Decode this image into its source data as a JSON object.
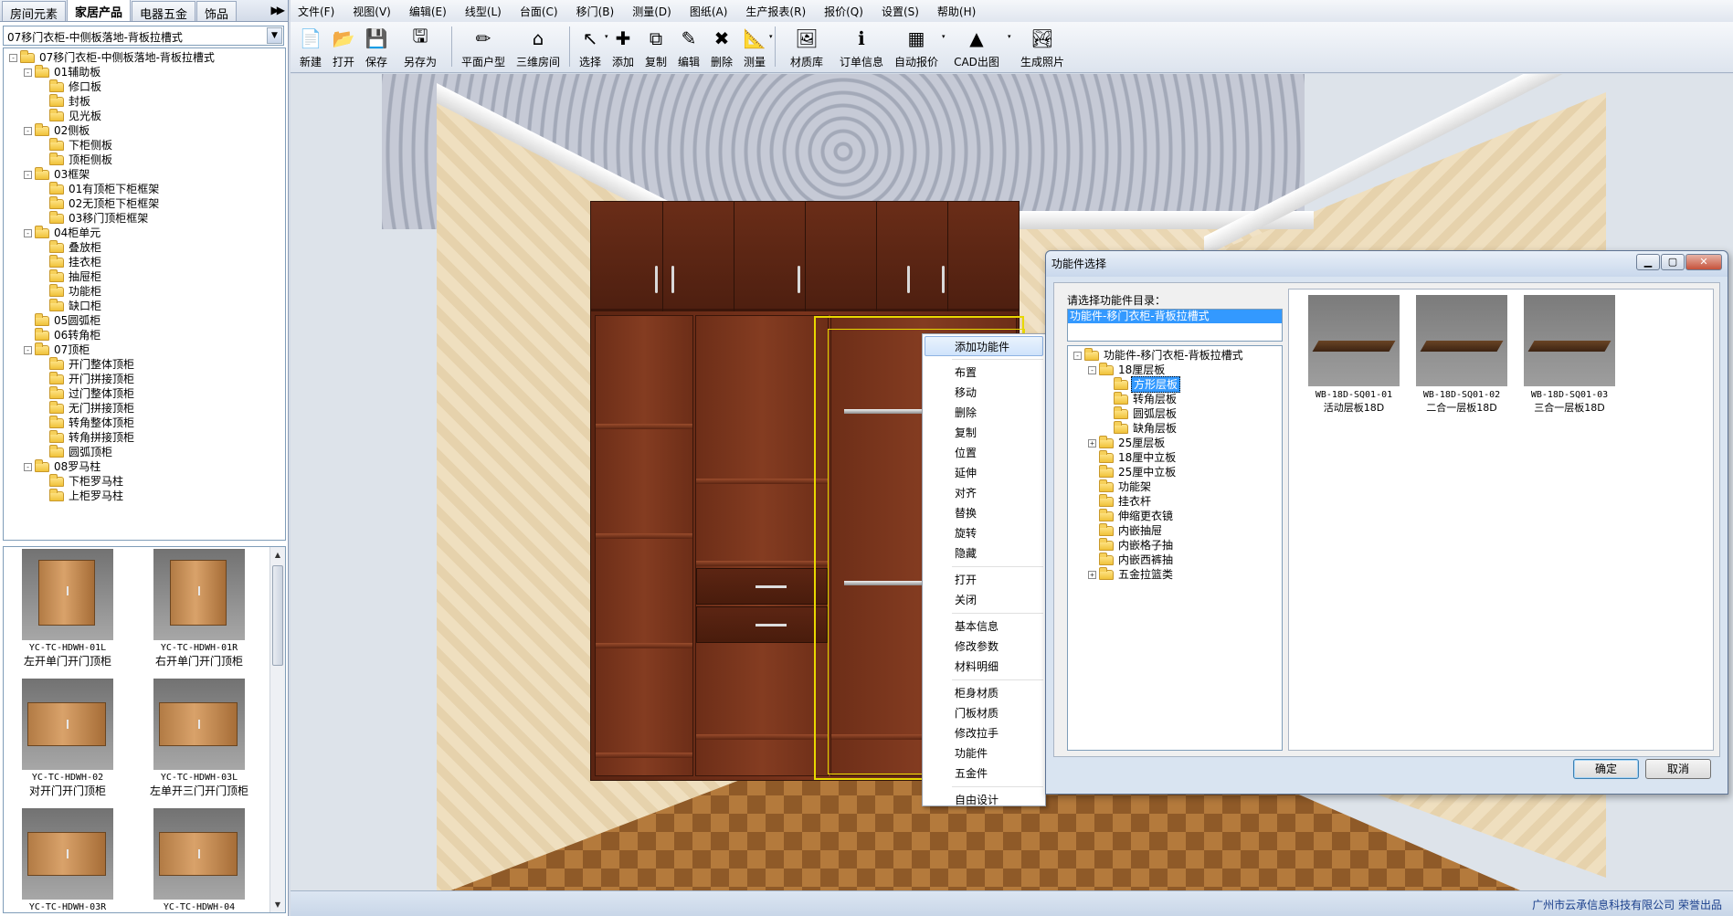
{
  "left_tabs": [
    "房间元素",
    "家居产品",
    "电器五金",
    "饰品"
  ],
  "left_tabs_active": 1,
  "combo_value": "07移门衣柜-中侧板落地-背板拉槽式",
  "tree": [
    {
      "label": "07移门衣柜-中侧板落地-背板拉槽式",
      "level": 0,
      "exp": "-"
    },
    {
      "label": "01辅助板",
      "level": 1,
      "exp": "-"
    },
    {
      "label": "修口板",
      "level": 2,
      "exp": ""
    },
    {
      "label": "封板",
      "level": 2,
      "exp": ""
    },
    {
      "label": "见光板",
      "level": 2,
      "exp": ""
    },
    {
      "label": "02侧板",
      "level": 1,
      "exp": "-"
    },
    {
      "label": "下柜侧板",
      "level": 2,
      "exp": ""
    },
    {
      "label": "顶柜侧板",
      "level": 2,
      "exp": ""
    },
    {
      "label": "03框架",
      "level": 1,
      "exp": "-"
    },
    {
      "label": "01有顶柜下柜框架",
      "level": 2,
      "exp": ""
    },
    {
      "label": "02无顶柜下柜框架",
      "level": 2,
      "exp": ""
    },
    {
      "label": "03移门顶柜框架",
      "level": 2,
      "exp": ""
    },
    {
      "label": "04柜单元",
      "level": 1,
      "exp": "-"
    },
    {
      "label": "叠放柜",
      "level": 2,
      "exp": ""
    },
    {
      "label": "挂衣柜",
      "level": 2,
      "exp": ""
    },
    {
      "label": "抽屉柜",
      "level": 2,
      "exp": ""
    },
    {
      "label": "功能柜",
      "level": 2,
      "exp": ""
    },
    {
      "label": "缺口柜",
      "level": 2,
      "exp": ""
    },
    {
      "label": "05圆弧柜",
      "level": 1,
      "exp": ""
    },
    {
      "label": "06转角柜",
      "level": 1,
      "exp": ""
    },
    {
      "label": "07顶柜",
      "level": 1,
      "exp": "-"
    },
    {
      "label": "开门整体顶柜",
      "level": 2,
      "exp": ""
    },
    {
      "label": "开门拼接顶柜",
      "level": 2,
      "exp": ""
    },
    {
      "label": "过门整体顶柜",
      "level": 2,
      "exp": ""
    },
    {
      "label": "无门拼接顶柜",
      "level": 2,
      "exp": ""
    },
    {
      "label": "转角整体顶柜",
      "level": 2,
      "exp": ""
    },
    {
      "label": "转角拼接顶柜",
      "level": 2,
      "exp": ""
    },
    {
      "label": "圆弧顶柜",
      "level": 2,
      "exp": ""
    },
    {
      "label": "08罗马柱",
      "level": 1,
      "exp": "-"
    },
    {
      "label": "下柜罗马柱",
      "level": 2,
      "exp": ""
    },
    {
      "label": "上柜罗马柱",
      "level": 2,
      "exp": ""
    }
  ],
  "thumbs": [
    {
      "code": "YC-TC-HDWH-01L",
      "name": "左开单门开门顶柜",
      "kind": "tall"
    },
    {
      "code": "YC-TC-HDWH-01R",
      "name": "右开单门开门顶柜",
      "kind": "tall"
    },
    {
      "code": "YC-TC-HDWH-02",
      "name": "对开门开门顶柜",
      "kind": "wide"
    },
    {
      "code": "YC-TC-HDWH-03L",
      "name": "左单开三门开门顶柜",
      "kind": "wide"
    },
    {
      "code": "YC-TC-HDWH-03R",
      "name": "",
      "kind": "wide"
    },
    {
      "code": "YC-TC-HDWH-04",
      "name": "",
      "kind": "wide"
    }
  ],
  "menu": [
    "文件(F)",
    "视图(V)",
    "编辑(E)",
    "线型(L)",
    "台面(C)",
    "移门(B)",
    "测量(D)",
    "图纸(A)",
    "生产报表(R)",
    "报价(Q)",
    "设置(S)",
    "帮助(H)"
  ],
  "toolbar": [
    {
      "label": "新建",
      "icon": "📄",
      "name": "new-icon",
      "w": ""
    },
    {
      "label": "打开",
      "icon": "📂",
      "name": "open-icon",
      "w": ""
    },
    {
      "label": "保存",
      "icon": "💾",
      "name": "save-icon",
      "w": ""
    },
    {
      "label": "另存为",
      "icon": "🖫",
      "name": "save-as-icon",
      "w": "wide"
    },
    {
      "sep": true
    },
    {
      "label": "平面户型",
      "icon": "✏",
      "name": "floor-plan-icon",
      "w": "wide"
    },
    {
      "label": "三维房间",
      "icon": "⌂",
      "name": "3d-room-icon",
      "w": "wide"
    },
    {
      "sep": true
    },
    {
      "label": "选择",
      "icon": "↖",
      "name": "select-icon",
      "w": "",
      "dd": true
    },
    {
      "label": "添加",
      "icon": "✚",
      "name": "add-icon",
      "w": ""
    },
    {
      "label": "复制",
      "icon": "⧉",
      "name": "copy-icon",
      "w": ""
    },
    {
      "label": "编辑",
      "icon": "✎",
      "name": "edit-icon",
      "w": ""
    },
    {
      "label": "删除",
      "icon": "✖",
      "name": "delete-icon",
      "w": ""
    },
    {
      "label": "测量",
      "icon": "📐",
      "name": "measure-icon",
      "w": "",
      "dd": true
    },
    {
      "sep": true
    },
    {
      "label": "材质库",
      "icon": "🖼",
      "name": "material-library-icon",
      "w": "wide"
    },
    {
      "label": "订单信息",
      "icon": "ℹ",
      "name": "order-info-icon",
      "w": "wide"
    },
    {
      "label": "自动报价",
      "icon": "▦",
      "name": "auto-quote-icon",
      "w": "wide",
      "dd": true
    },
    {
      "label": "CAD出图",
      "icon": "▲",
      "name": "cad-icon",
      "w": "wider",
      "dd": true
    },
    {
      "label": "生成照片",
      "icon": "🏞",
      "name": "generate-photo-icon",
      "w": "wider"
    }
  ],
  "context_menu": [
    {
      "label": "添加功能件",
      "hl": true
    },
    {
      "sep": true
    },
    {
      "label": "布置"
    },
    {
      "label": "移动"
    },
    {
      "label": "删除"
    },
    {
      "label": "复制"
    },
    {
      "label": "位置"
    },
    {
      "label": "延伸"
    },
    {
      "label": "对齐"
    },
    {
      "label": "替换"
    },
    {
      "label": "旋转"
    },
    {
      "label": "隐藏"
    },
    {
      "sep": true
    },
    {
      "label": "打开"
    },
    {
      "label": "关闭"
    },
    {
      "sep": true
    },
    {
      "label": "基本信息"
    },
    {
      "label": "修改参数"
    },
    {
      "label": "材料明细"
    },
    {
      "sep": true
    },
    {
      "label": "柜身材质"
    },
    {
      "label": "门板材质"
    },
    {
      "label": "修改拉手"
    },
    {
      "label": "功能件"
    },
    {
      "label": "五金件"
    },
    {
      "sep": true
    },
    {
      "label": "自由设计"
    }
  ],
  "dialog": {
    "title": "功能件选择",
    "prompt": "请选择功能件目录：",
    "path": "功能件-移门衣柜-背板拉槽式",
    "tree": [
      {
        "label": "功能件-移门衣柜-背板拉槽式",
        "level": 0,
        "exp": "-"
      },
      {
        "label": "18厘层板",
        "level": 1,
        "exp": "-"
      },
      {
        "label": "方形层板",
        "level": 2,
        "exp": "",
        "sel": true
      },
      {
        "label": "转角层板",
        "level": 2,
        "exp": ""
      },
      {
        "label": "圆弧层板",
        "level": 2,
        "exp": ""
      },
      {
        "label": "缺角层板",
        "level": 2,
        "exp": ""
      },
      {
        "label": "25厘层板",
        "level": 1,
        "exp": "+"
      },
      {
        "label": "18厘中立板",
        "level": 1,
        "exp": ""
      },
      {
        "label": "25厘中立板",
        "level": 1,
        "exp": ""
      },
      {
        "label": "功能架",
        "level": 1,
        "exp": ""
      },
      {
        "label": "挂衣杆",
        "level": 1,
        "exp": ""
      },
      {
        "label": "伸缩更衣镜",
        "level": 1,
        "exp": ""
      },
      {
        "label": "内嵌抽屉",
        "level": 1,
        "exp": ""
      },
      {
        "label": "内嵌格子抽",
        "level": 1,
        "exp": ""
      },
      {
        "label": "内嵌西裤抽",
        "level": 1,
        "exp": ""
      },
      {
        "label": "五金拉篮类",
        "level": 1,
        "exp": "+"
      }
    ],
    "items": [
      {
        "code": "WB-18D-SQ01-01",
        "name": "活动层板18D"
      },
      {
        "code": "WB-18D-SQ01-02",
        "name": "二合一层板18D"
      },
      {
        "code": "WB-18D-SQ01-03",
        "name": "三合一层板18D"
      }
    ],
    "ok": "确定",
    "cancel": "取消"
  },
  "status_text": "广州市云承信息科技有限公司 荣誉出品"
}
